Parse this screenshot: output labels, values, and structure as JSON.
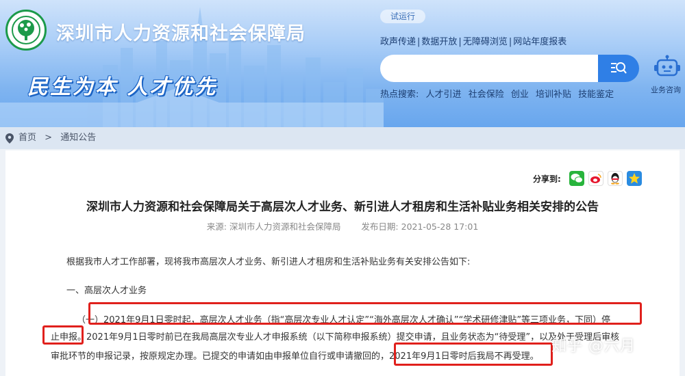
{
  "header": {
    "site_title": "深圳市人力资源和社会保障局",
    "slogan": "民生为本 人才优先",
    "trial_badge": "试运行",
    "top_links": [
      "政声传递",
      "数据开放",
      "无障碍浏览",
      "网站年度报表"
    ],
    "search": {
      "placeholder": "",
      "value": ""
    },
    "hot_search_label": "热点搜索:",
    "hot_search_items": [
      "人才引进",
      "社会保险",
      "创业",
      "培训补贴",
      "技能鉴定"
    ],
    "robot_label": "业务咨询"
  },
  "breadcrumb": {
    "home": "首页",
    "separator": ">",
    "current": "通知公告"
  },
  "share": {
    "label": "分享到:",
    "icons": [
      "wechat-icon",
      "weibo-icon",
      "qq-icon",
      "qzone-icon"
    ]
  },
  "article": {
    "title": "深圳市人力资源和社会保障局关于高层次人才业务、新引进人才租房和生活补贴业务相关安排的公告",
    "source_label": "来源:",
    "source": "深圳市人力资源和社会保障局",
    "date_label": "发布日期:",
    "date": "2021-05-28 17:01",
    "intro": "根据我市人才工作部署，现将我市高层次人才业务、新引进人才租房和生活补贴业务有关安排公告如下:",
    "section1": "一、高层次人才业务",
    "line1_prefix": "（一）",
    "line1_highlight": "2021年9月1日零时起，高层次人才业务（指“高层次专业人才认定”“海外高层次人才确认”“学术研修津贴”等三项业务，下同）停",
    "line2_highlight": "止申报。",
    "line2_rest": "2021年9月1日零时前已在我局高层次专业人才申报系统（以下简称申报系统）提交申请，且业务状态为“待受理”，以及处于受理后审核",
    "line3_rest": "审批环节的申报记录，按原规定办理。已提交的申请如由申报单位自行或申请撤回的，",
    "line3_highlight": "2021年9月1日零时后我局不再受理。"
  },
  "watermark": "知乎 @六月",
  "colors": {
    "header_blue": "#68a6ee",
    "search_button": "#2f7fe6",
    "highlight_red": "#e0201c",
    "logo_green": "#1c9a4a"
  }
}
